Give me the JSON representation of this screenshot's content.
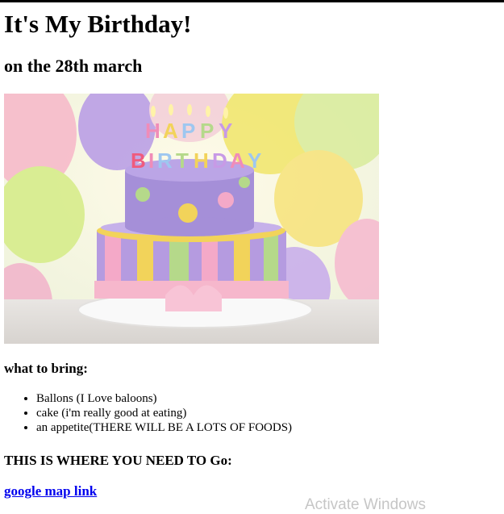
{
  "header": {
    "title": "It's My Birthday!",
    "subtitle": "on the 28th march"
  },
  "image": {
    "subject": "birthday-cake",
    "topper_text": "HAPPY BIRTHDAY"
  },
  "bring": {
    "heading": "what to bring:",
    "items": [
      "Ballons (I Love baloons)",
      "cake (i'm really good at eating)",
      "an appetite(THERE WILL BE A LOTS OF FOODS)"
    ]
  },
  "location": {
    "heading": "THIS IS WHERE YOU NEED TO Go:",
    "link_label": "google map link"
  },
  "overlay": {
    "watermark": "Activate Windows"
  },
  "colors": {
    "link": "#0000ee",
    "cake_purple": "#a58fd8",
    "cake_pink": "#f4a9c8",
    "cake_yellow": "#f2d35a",
    "cake_green": "#b5d98a"
  }
}
